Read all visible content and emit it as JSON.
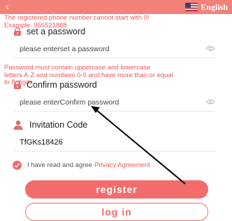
{
  "header": {
    "back_icon": "chevron-left-icon",
    "back_glyph": "‹",
    "language_label": "English",
    "flag_icon": "us-flag-icon",
    "bar_color": "#f4807a"
  },
  "messages": {
    "phone_error": "The registered phone number cannot start with 0!\nExample: 956521888",
    "password_rule": "Password must contain uppercase and lowercase\nletters A-Z and numbers 0-9 and have more than or equal\nto 8 digits"
  },
  "form": {
    "set_password": {
      "label": "set a password",
      "placeholder": "please enterset a password",
      "icon": "lock-icon",
      "toggle_icon": "eye-icon"
    },
    "confirm_password": {
      "label": "Confirm password",
      "placeholder": "please enterConfirm password",
      "icon": "lock-icon",
      "toggle_icon": "eye-icon"
    },
    "invitation": {
      "label": "Invitation Code",
      "value": "TfGKs18426",
      "icon": "user-icon"
    }
  },
  "agreement": {
    "text": "I have read and agree",
    "link": "Privacy Agreement",
    "checked": true
  },
  "buttons": {
    "register": "register",
    "login": "log in"
  },
  "colors": {
    "accent": "#f26c6c",
    "error_text": "#ee5b5b"
  }
}
